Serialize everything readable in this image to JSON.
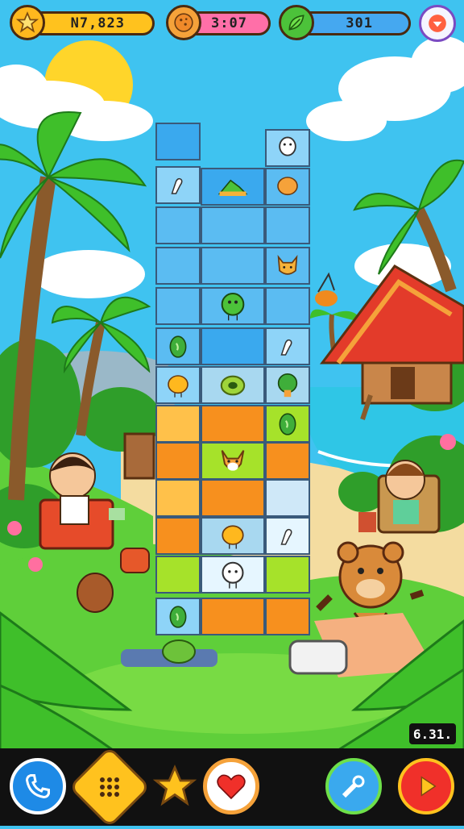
{
  "hud": {
    "coins": "N7,823",
    "food": "3:07",
    "energy": "301"
  },
  "timer": "6.31.",
  "colors": {
    "sky": "#3fc3f0",
    "grass": "#5fcf3a",
    "sand": "#f4dca0",
    "water": "#2fc6e6"
  },
  "board": {
    "columns": 3,
    "rows": 13
  },
  "icons": {
    "coin": "star-coin-icon",
    "food": "cookie-icon",
    "energy": "leaf-icon",
    "menu": "down-arrow-icon"
  },
  "bottom_buttons": [
    "phone-icon",
    "dots-grid-icon",
    "star-icon",
    "heart-icon",
    "tools-icon",
    "play-icon"
  ]
}
